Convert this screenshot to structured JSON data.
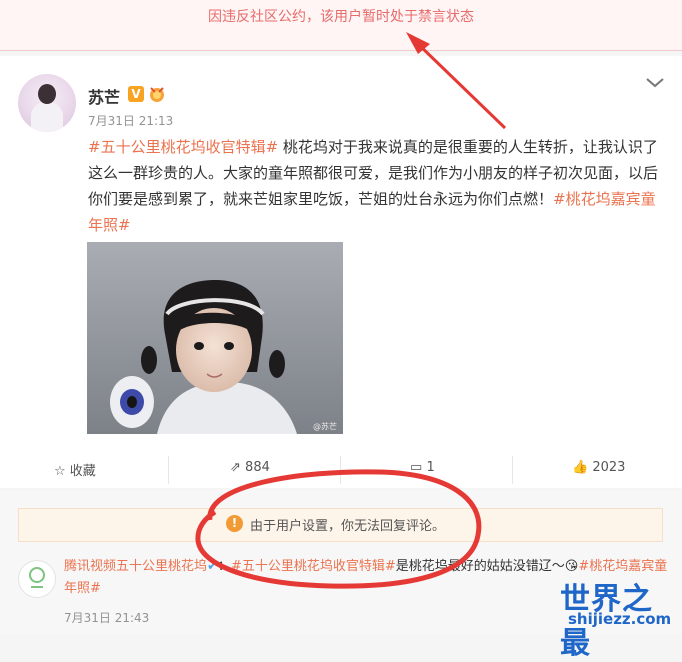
{
  "banner": {
    "text": "因违反社区公约，该用户暂时处于禁言状态"
  },
  "post": {
    "username": "苏芒",
    "verified_badge": "V",
    "time": "7月31日 21:13",
    "body_tag1": "#五十公里桃花坞收官特辑#",
    "body_text": " 桃花坞对于我来说真的是很重要的人生转折，让我认识了这么一群珍贵的人。大家的童年照都很可爱，是我们作为小朋友的样子初次见面，以后你们要是感到累了，就来芒姐家里吃饭，芒姐的灶台永远为你们点燃！",
    "body_tag2": "#桃花坞嘉宾童年照#",
    "photo_watermark": "@苏芒"
  },
  "actions": {
    "favorite_label": "收藏",
    "repost_count": "884",
    "comment_count": "1",
    "like_count": "2023"
  },
  "notice": {
    "text": "由于用户设置，你无法回复评论。"
  },
  "comment": {
    "author": "腾讯视频五十公里桃花坞",
    "sep": "：",
    "tag1": "#五十公里桃花坞收官特辑#",
    "text": "是桃花坞最好的姑姑没错辽～",
    "tag2": "#桃花坞嘉宾童年照#",
    "time": "7月31日 21:43"
  },
  "watermark": {
    "title": "世界之最",
    "domain": "shijiezz.com"
  },
  "colors": {
    "accent": "#eb7350",
    "annotation_red": "#e53935",
    "banner_text": "#e86b6b"
  }
}
